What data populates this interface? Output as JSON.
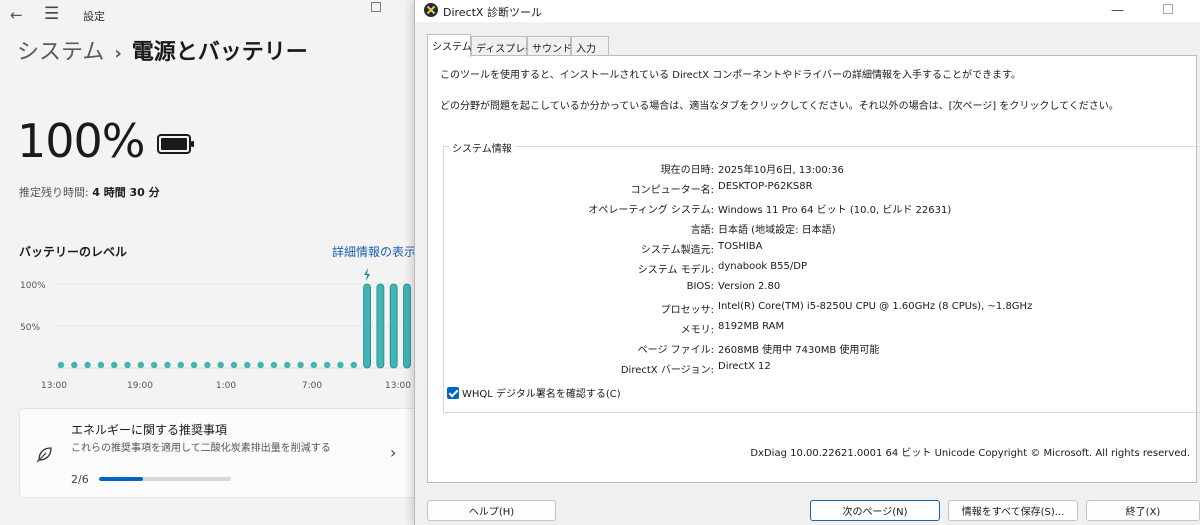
{
  "settings": {
    "app_title": "設定",
    "breadcrumb": {
      "parent": "システム",
      "separator": "›",
      "current": "電源とバッテリー"
    },
    "battery_percent": "100%",
    "remaining_label": "推定残り時間:",
    "remaining_value": "4 時間 30 分",
    "level_title": "バッテリーのレベル",
    "details_link": "詳細情報の表示",
    "chart_data": {
      "type": "bar",
      "title": "",
      "xlabel": "",
      "ylabel": "",
      "ylim": [
        0,
        100
      ],
      "y_ticks": [
        "100%",
        "50%"
      ],
      "x_tick_labels": [
        "13:00",
        "19:00",
        "1:00",
        "7:00",
        "13:00"
      ],
      "values": [
        null,
        null,
        null,
        null,
        null,
        null,
        null,
        null,
        null,
        null,
        null,
        null,
        null,
        null,
        null,
        null,
        null,
        null,
        null,
        null,
        null,
        null,
        null,
        100,
        100,
        100,
        100
      ],
      "charging_marker_index": 23,
      "grid": true,
      "bar_color": "#41b4b4"
    },
    "recommendation": {
      "title": "エネルギーに関する推奨事項",
      "subtitle": "これらの推奨事項を適用して二酸化炭素排出量を削減する",
      "progress_text": "2/6",
      "progress_value": 0.33
    }
  },
  "dxdiag": {
    "title": "DirectX 診断ツール",
    "tabs": [
      {
        "label": "システム",
        "active": true
      },
      {
        "label": "ディスプレイ",
        "active": false
      },
      {
        "label": "サウンド",
        "active": false
      },
      {
        "label": "入力",
        "active": false
      }
    ],
    "intro_line1": "このツールを使用すると、インストールされている DirectX コンポーネントやドライバーの詳細情報を入手することができます。",
    "intro_line2": "どの分野が問題を起こしているか分かっている場合は、適当なタブをクリックしてください。それ以外の場合は、[次ページ] をクリックしてください。",
    "system_info_label": "システム情報",
    "rows": [
      {
        "key": "現在の日時:",
        "value": "2025年10月6日, 13:00:36"
      },
      {
        "key": "コンピューター名:",
        "value": "DESKTOP-P62KS8R"
      },
      {
        "key": "オペレーティング システム:",
        "value": "Windows 11 Pro 64 ビット (10.0, ビルド 22631)"
      },
      {
        "key": "言語:",
        "value": "日本語 (地域設定: 日本語)"
      },
      {
        "key": "システム製造元:",
        "value": "TOSHIBA"
      },
      {
        "key": "システム モデル:",
        "value": "dynabook B55/DP"
      },
      {
        "key": "BIOS:",
        "value": "Version 2.80"
      },
      {
        "key": "プロセッサ:",
        "value": "Intel(R) Core(TM) i5-8250U CPU @ 1.60GHz (8 CPUs), ~1.8GHz"
      },
      {
        "key": "メモリ:",
        "value": "8192MB RAM"
      },
      {
        "key": "ページ ファイル:",
        "value": "2608MB 使用中 7430MB 使用可能"
      },
      {
        "key": "DirectX バージョン:",
        "value": "DirectX 12"
      }
    ],
    "whql_label": "WHQL デジタル署名を確認する(C)",
    "whql_checked": true,
    "footer": "DxDiag 10.00.22621.0001 64 ビット Unicode  Copyright © Microsoft. All rights reserved.",
    "buttons": {
      "help": "ヘルプ(H)",
      "next": "次のページ(N)",
      "save": "情報をすべて保存(S)...",
      "exit": "終了(X)"
    }
  }
}
